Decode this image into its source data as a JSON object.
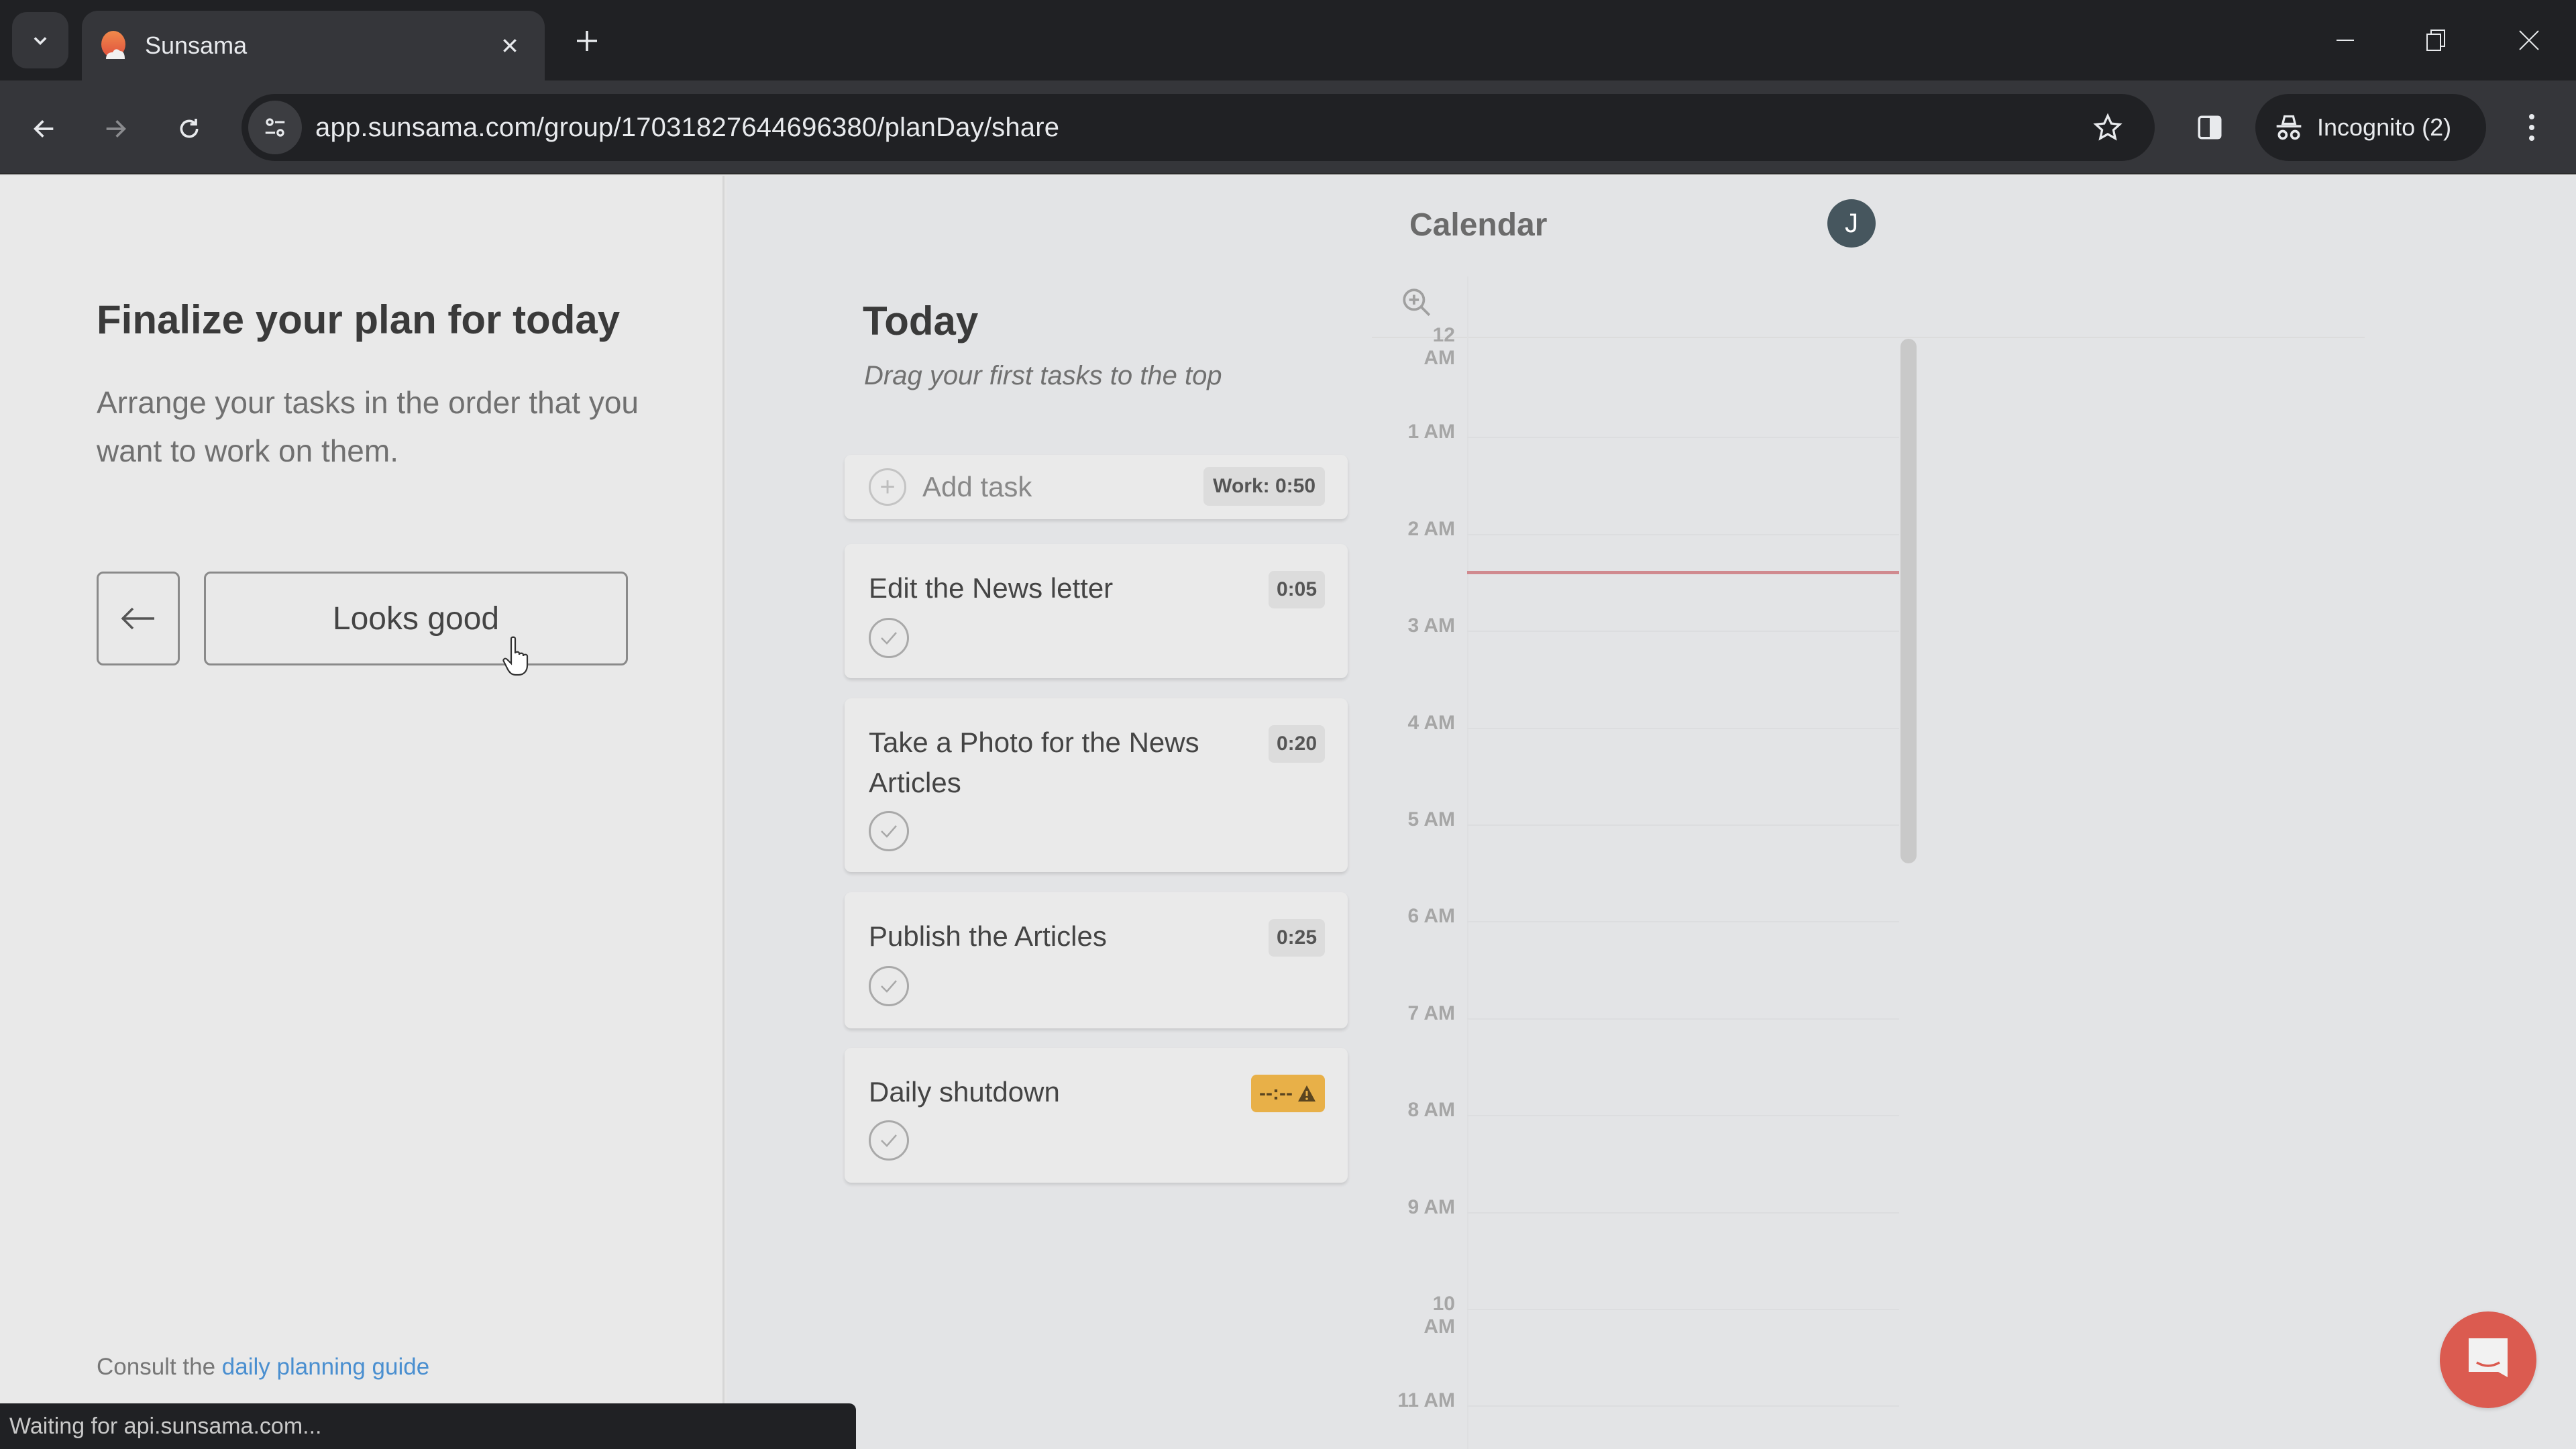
{
  "browser": {
    "tab_title": "Sunsama",
    "url": "app.sunsama.com/group/17031827644696380/planDay/share",
    "incognito_label": "Incognito (2)",
    "status_text": "Waiting for api.sunsama.com...",
    "icons": {
      "tab_search": "chevron-down-icon",
      "favicon": "sunsama-logo-icon",
      "close_tab": "close-icon",
      "new_tab": "plus-icon",
      "minimize": "minimize-icon",
      "restore": "restore-icon",
      "close_window": "close-icon",
      "back": "arrow-left-icon",
      "forward": "arrow-right-icon",
      "reload": "reload-icon",
      "site_info": "tune-icon",
      "bookmark": "star-icon",
      "side_panel": "side-panel-icon",
      "incognito": "incognito-icon",
      "menu": "more-vertical-icon"
    }
  },
  "left_panel": {
    "title": "Finalize your plan for today",
    "description": "Arrange your tasks in the order that you want to work on them.",
    "back_button_icon": "arrow-left-icon",
    "primary_button": "Looks good",
    "footer_prefix": "Consult the ",
    "footer_link": "daily planning guide"
  },
  "today": {
    "title": "Today",
    "subtitle": "Drag your first tasks to the top",
    "add_task_label": "Add task",
    "work_total": "Work: 0:50",
    "tasks": [
      {
        "title": "Edit the News letter",
        "time": "0:05",
        "warning": false
      },
      {
        "title": "Take a Photo for the News Articles",
        "time": "0:20",
        "warning": false
      },
      {
        "title": "Publish the Articles",
        "time": "0:25",
        "warning": false
      },
      {
        "title": "Daily shutdown",
        "time": "--:--",
        "warning": true
      }
    ]
  },
  "calendar": {
    "title": "Calendar",
    "avatar_initial": "J",
    "hours": [
      "12 AM",
      "1 AM",
      "2 AM",
      "3 AM",
      "4 AM",
      "5 AM",
      "6 AM",
      "7 AM",
      "8 AM",
      "9 AM",
      "10 AM",
      "11 AM"
    ],
    "current_time_hours": 2.38
  },
  "colors": {
    "accent_link": "#4a8fd0",
    "now_line": "#d08a8f",
    "warning_badge": "#e8b048",
    "chat_button": "#db5b50",
    "avatar": "#46565e"
  }
}
